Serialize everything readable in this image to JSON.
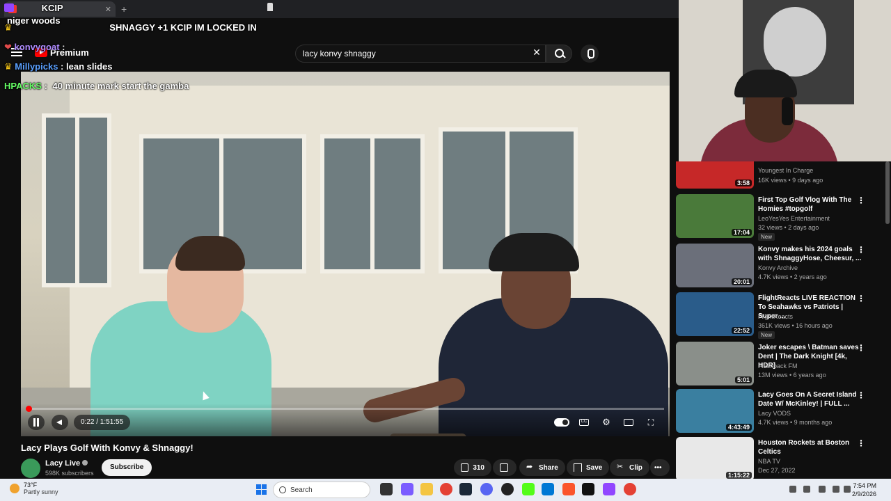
{
  "browser": {
    "tab_title": "",
    "new_tab": "+"
  },
  "chat": {
    "lines": [
      {
        "user": "",
        "text": "KCIP",
        "user_color": "#ff77cc",
        "text_color": "#ffffff"
      },
      {
        "user": "niger woods",
        "text": "",
        "user_color": "#ffffff",
        "text_color": "#ffffff"
      },
      {
        "user": "",
        "text": "SHNAGGY +1 KCIP IM LOCKED IN",
        "user_color": "#e14b4b",
        "text_color": "#ffffff"
      },
      {
        "user": "konvygoat",
        "text": "",
        "user_color": "#b08cff",
        "text_color": "#ffffff"
      },
      {
        "user": "Millypicks",
        "text": "lean slides",
        "user_color": "#5aa0ff",
        "text_color": "#ffffff"
      },
      {
        "user": "HPACKS",
        "text": "40 minute mark start the gamba",
        "user_color": "#66ff66",
        "text_color": "#ffffff"
      }
    ]
  },
  "youtube": {
    "logo_label": "Premium",
    "search_value": "lacy konvy shnaggy",
    "player": {
      "current_time": "0:22",
      "total_time": "1:51:55",
      "time_display": "0:22 / 1:51:55",
      "progress": 0.003
    },
    "video": {
      "title": "Lacy Plays Golf With Konvy & Shnaggy!",
      "channel": "Lacy Live",
      "subscribers": "598K subscribers",
      "subscribe_label": "Subscribe",
      "likes": "310",
      "share_label": "Share",
      "save_label": "Save",
      "clip_label": "Clip",
      "more_label": "•••"
    },
    "recommendations": [
      {
        "title": "",
        "channel": "Youngest In Charge",
        "meta": "16K views • 9 days ago",
        "duration": "3:58",
        "new": "",
        "thumb_color": "#c62828"
      },
      {
        "title": "First Top Golf Vlog With The Homies #topgolf",
        "channel": "LeoYesYes Entertainment",
        "meta": "32 views • 2 days ago",
        "duration": "17:04",
        "new": "New",
        "thumb_color": "#4a7a3a"
      },
      {
        "title": "Konvy makes his 2024 goals with ShnaggyHose, Cheesur, ...",
        "channel": "Konvy Archive",
        "meta": "4.7K views • 2 years ago",
        "duration": "20:01",
        "new": "",
        "thumb_color": "#6b6f7a"
      },
      {
        "title": "FlightReacts LIVE REACTION To Seahawks vs Patriots | Super ...",
        "channel": "FlightReacts",
        "meta": "361K views • 16 hours ago",
        "duration": "22:52",
        "new": "New",
        "thumb_color": "#2a5c8a"
      },
      {
        "title": "Joker escapes \\ Batman saves Dent | The Dark Knight [4k, HDR]",
        "channel": "Flashback FM",
        "meta": "13M views • 6 years ago",
        "duration": "5:01",
        "new": "",
        "thumb_color": "#8a8f8a"
      },
      {
        "title": "Lacy Goes On A Secret Island Date W/ McKinley! | FULL ...",
        "channel": "Lacy VODS",
        "meta": "4.7K views • 9 months ago",
        "duration": "4:43:49",
        "new": "",
        "thumb_color": "#3a7fa0"
      },
      {
        "title": "Houston Rockets at Boston Celtics",
        "channel": "NBA TV",
        "meta": "Dec 27, 2022",
        "duration": "1:15:22",
        "new": "",
        "thumb_color": "#e8e8e8"
      }
    ]
  },
  "taskbar": {
    "temperature": "73°F",
    "condition": "Partly sunny",
    "search_placeholder": "Search",
    "time": "7:54 PM",
    "date": "2/9/2026"
  }
}
